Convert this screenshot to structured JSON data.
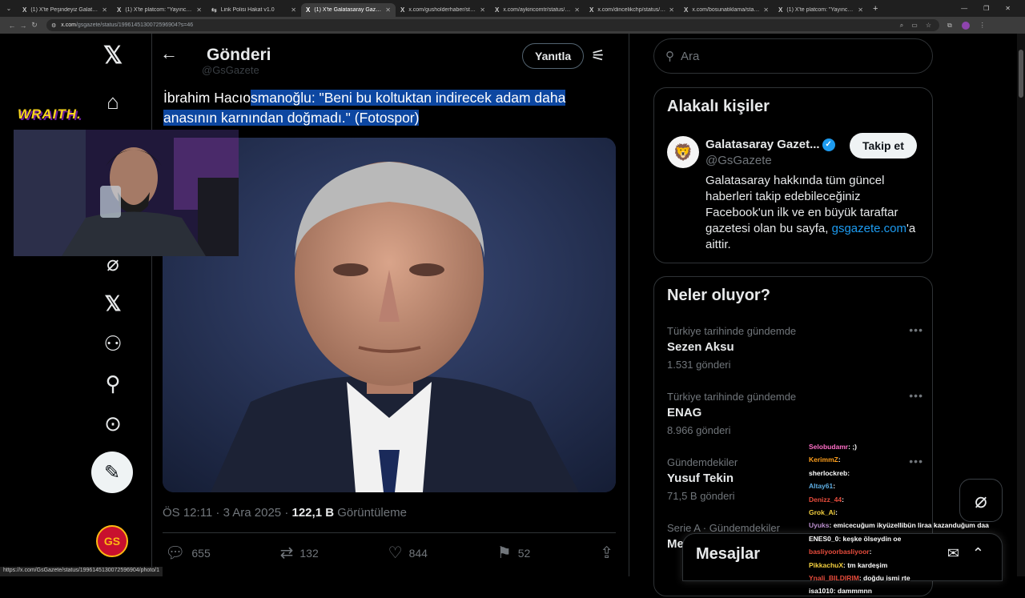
{
  "browser": {
    "tabs": [
      {
        "label": "(1) X'te Peşindeyiz Galatasaray",
        "fav": "X",
        "active": false
      },
      {
        "label": "(1) X'te platcom: \"Yayıncı İranlı",
        "fav": "X",
        "active": false
      },
      {
        "label": "Link Polisi Hakat v1.0",
        "fav": "⇆",
        "active": false
      },
      {
        "label": "(1) X'te Galatasaray Gazetesi",
        "fav": "X",
        "active": true
      },
      {
        "label": "x.com/gusholderhaber/status/1",
        "fav": "X",
        "active": false
      },
      {
        "label": "x.com/aykiricomtr/status/1995",
        "fav": "X",
        "active": false
      },
      {
        "label": "x.com/dincelikchp/status/1998",
        "fav": "X",
        "active": false
      },
      {
        "label": "x.com/bosunatiklama/status/1",
        "fav": "X",
        "active": false
      },
      {
        "label": "(1) X'te platcom: \"Yayıncı İranlı",
        "fav": "X",
        "active": false
      }
    ],
    "url_domain": "x.com",
    "url_path": "/gsgazete/status/1996145130072596904?s=46",
    "status_url": "https://x.com/GsGazete/status/1996145130072596904/photo/1"
  },
  "header": {
    "title": "Gönderi",
    "reply_label": "Yanıtla",
    "handle_ghost": "@GsGazete"
  },
  "tweet": {
    "text_pre": "İbrahim Hacıo",
    "text_highlight": "smanoğlu: \"Beni bu koltuktan indirecek adam daha anasının karnından doğmadı.\"",
    "text_post": " (Fotospor)",
    "time": "ÖS 12:11 · 3 Ara 2025",
    "views": "122,1 B",
    "views_label": "Görüntüleme",
    "replies": "655",
    "retweets": "132",
    "likes": "844",
    "bookmarks": "52"
  },
  "search": {
    "placeholder": "Ara"
  },
  "related": {
    "title": "Alakalı kişiler",
    "name": "Galatasaray Gazet...",
    "handle": "@GsGazete",
    "follow_label": "Takip et",
    "bio_pre": "Galatasaray hakkında tüm güncel haberleri takip edebileceğiniz Facebook'un ilk ve en büyük taraftar gazetesi olan bu sayfa, ",
    "bio_link": "gsgazete.com",
    "bio_post": "'a aittir."
  },
  "trends": {
    "title": "Neler oluyor?",
    "items": [
      {
        "category": "Türkiye tarihinde gündemde",
        "name": "Sezen Aksu",
        "count": "1.531 gönderi"
      },
      {
        "category": "Türkiye tarihinde gündemde",
        "name": "ENAG",
        "count": "8.966 gönderi"
      },
      {
        "category": "Gündemdekiler",
        "name": "Yusuf Tekin",
        "count": "71,5 B gönderi"
      },
      {
        "category": "Serie A · Gündemdekiler",
        "name": "Me",
        "count": ""
      }
    ]
  },
  "messages": {
    "title": "Mesajlar"
  },
  "overlay": {
    "logo": "WRAITH.",
    "chat": [
      {
        "user": "Selobudamr",
        "color": "#ff6ec7",
        "msg": ": ;)"
      },
      {
        "user": "KerimmZ",
        "color": "#ff9f1c",
        "msg": ":"
      },
      {
        "user": "sherlockreb",
        "color": "#ffffff",
        "msg": ":"
      },
      {
        "user": "Altay61",
        "color": "#5dade2",
        "msg": ":"
      },
      {
        "user": "Denizz_44",
        "color": "#e74c3c",
        "msg": ":"
      },
      {
        "user": "Grok_Ai",
        "color": "#f4d03f",
        "msg": ":"
      },
      {
        "user": "Uyuks",
        "color": "#bb8fce",
        "msg": ": emicecuğum ikyüzellibün liraa kazanduğum daa"
      },
      {
        "user": "ENES0_0",
        "color": "#ffffff",
        "msg": ": keşke ölseydin oe"
      },
      {
        "user": "basliyoorbasliyoor",
        "color": "#e74c3c",
        "msg": ":"
      },
      {
        "user": "PikkachuX",
        "color": "#f4d03f",
        "msg": ": tm kardeşim"
      },
      {
        "user": "Ynali_BILDIRIM",
        "color": "#e74c3c",
        "msg": ": doğdu ismi rte"
      },
      {
        "user": "isa1010",
        "color": "#ffffff",
        "msg": ": dammmnn"
      }
    ]
  },
  "colors": {
    "accent": "#1d9bf0",
    "border": "#2f3336",
    "muted": "#71767b",
    "highlight": "#0d47a1"
  }
}
